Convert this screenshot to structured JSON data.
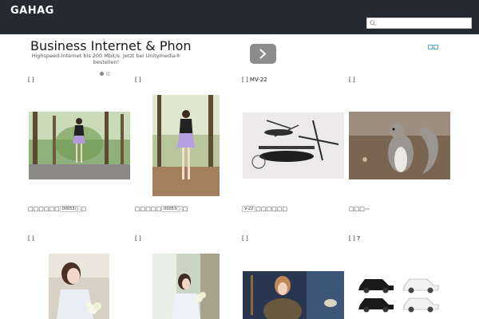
{
  "header": {
    "logo": "GAHAG",
    "search_placeholder": ""
  },
  "ad": {
    "title": "Business Internet & Phon",
    "text": "Highspeed-Internet bis 200 Mbit/s. Jetzt bei Unitymedia® bestellen!",
    "next_icon": "chevron-right-icon",
    "badge_icon": "ad-choices-icon"
  },
  "cards": [
    {
      "label": "[        ]",
      "caption": "□□□□□□",
      "tag": "00053□",
      "caption_tail": "□",
      "image": "woman-in-park-photo"
    },
    {
      "label": "[        ]",
      "caption": "□□□□□",
      "tag": "00053□",
      "caption_tail": "□",
      "image": "woman-standing-path-photo"
    },
    {
      "label": "[        ]      MV-22",
      "caption": "",
      "tag": "V-22",
      "caption_tail": "□□□□□□",
      "image": "osprey-models-photo"
    },
    {
      "label": "[        ]",
      "caption": "□□□",
      "tag": "      ",
      "caption_tail": "",
      "image": "squirrel-photo"
    },
    {
      "label": "[        ]",
      "caption": "",
      "tag": "",
      "caption_tail": "",
      "image": "woman-with-flowers-photo"
    },
    {
      "label": "[        ]",
      "caption": "",
      "tag": "",
      "caption_tail": "",
      "image": "woman-with-flowers-2-photo"
    },
    {
      "label": "[        ]",
      "caption": "",
      "tag": "",
      "caption_tail": "",
      "image": "woman-in-fur-photo"
    },
    {
      "label": "[        ] 7",
      "caption": "",
      "tag": "",
      "caption_tail": "",
      "image": "classic-cars-photo"
    }
  ]
}
